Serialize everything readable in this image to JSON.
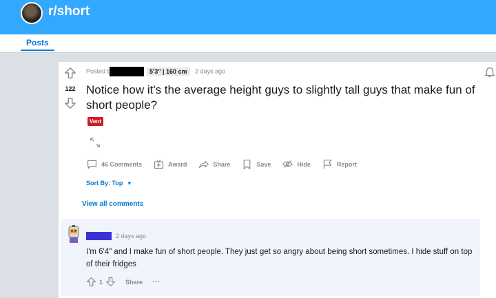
{
  "header": {
    "subreddit": "r/short",
    "accent": "#33a8ff"
  },
  "tabs": {
    "posts": "Posts"
  },
  "post": {
    "posted_by": "Posted b",
    "user_flair": "5'3\" | 160 cm",
    "age": "2 days ago",
    "votes": "122",
    "title": "Notice how it's the average height guys to slightly tall guys that make fun of short people?",
    "post_flair": "Vent",
    "flair_color": "#cc1d26",
    "actions": {
      "comments": "46 Comments",
      "award": "Award",
      "share": "Share",
      "save": "Save",
      "hide": "Hide",
      "report": "Report"
    },
    "sort_by": "Sort By: Top",
    "view_all": "View all comments"
  },
  "comment": {
    "age": "2 days ago",
    "text": "I'm 6'4\" and I make fun of short people. They just get so angry about being short sometimes. I hide stuff on top of their fridges",
    "votes": "1",
    "share": "Share",
    "more": "···"
  }
}
